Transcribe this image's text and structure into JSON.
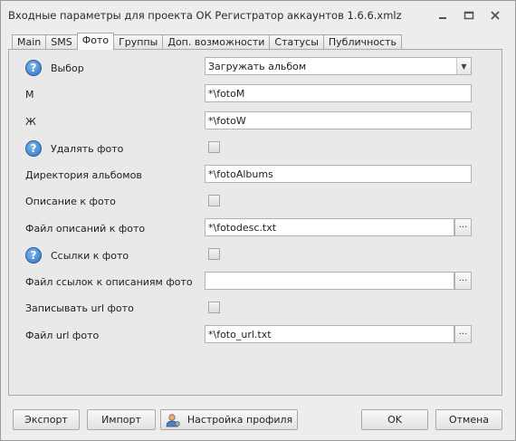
{
  "window": {
    "title": "Входные параметры для проекта ОК Регистратор аккаунтов 1.6.6.xmlz"
  },
  "tabs": [
    {
      "label": "Main"
    },
    {
      "label": "SMS"
    },
    {
      "label": "Фото"
    },
    {
      "label": "Группы"
    },
    {
      "label": "Доп. возможности"
    },
    {
      "label": "Статусы"
    },
    {
      "label": "Публичность"
    }
  ],
  "active_tab": "Фото",
  "form": {
    "vybor": {
      "label": "Выбор",
      "value": "Загружать альбом"
    },
    "m": {
      "label": "М",
      "value": "*\\fotoM"
    },
    "zh": {
      "label": "Ж",
      "value": "*\\fotoW"
    },
    "delete_photo": {
      "label": "Удалять фото",
      "checked": false
    },
    "albums_dir": {
      "label": "Директория альбомов",
      "value": "*\\fotoAlbums"
    },
    "photo_desc": {
      "label": "Описание к фото",
      "checked": false
    },
    "desc_file": {
      "label": "Файл описаний к фото",
      "value": "*\\fotodesc.txt"
    },
    "photo_links": {
      "label": "Ссылки к фото",
      "checked": false
    },
    "links_file": {
      "label": "Файл ссылок к описаниям фото",
      "value": ""
    },
    "write_url": {
      "label": "Записывать url фото",
      "checked": false
    },
    "url_file": {
      "label": "Файл url фото",
      "value": "*\\foto_url.txt"
    }
  },
  "buttons": {
    "export": "Экспорт",
    "import": "Импорт",
    "profile": "Настройка профиля",
    "ok": "OK",
    "cancel": "Отмена",
    "browse": "···"
  },
  "colors": {
    "help_icon": "#2f74c0",
    "background": "#ededed"
  }
}
